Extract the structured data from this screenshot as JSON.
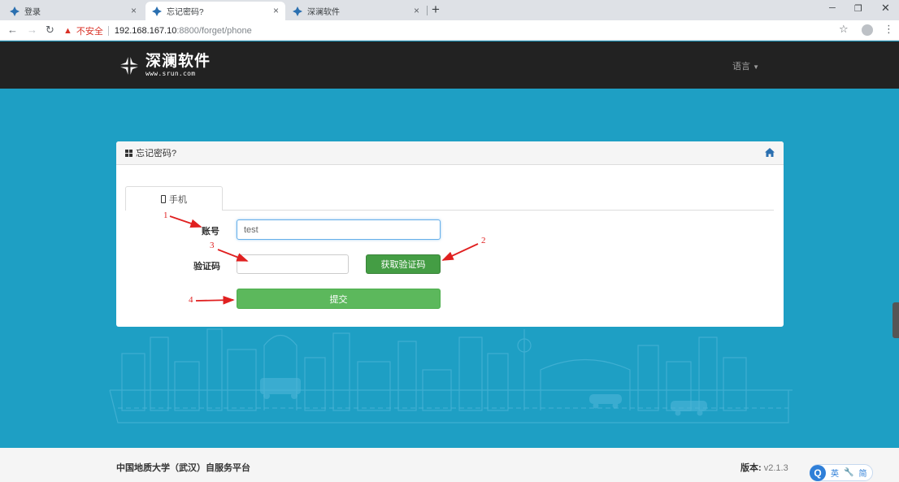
{
  "browser": {
    "tabs": [
      {
        "title": "登录",
        "active": false
      },
      {
        "title": "忘记密码?",
        "active": true
      },
      {
        "title": "深澜软件",
        "active": false
      }
    ],
    "new_tab": "+",
    "security_label": "不安全",
    "url_host": "192.168.167.10",
    "url_rest": ":8800/forget/phone"
  },
  "header": {
    "logo_name": "深澜软件",
    "logo_url": "www.srun.com",
    "language_menu": "语言"
  },
  "panel": {
    "title": "忘记密码?",
    "tab_label": "手机",
    "account_label": "账号",
    "account_value": "test",
    "code_label": "验证码",
    "code_value": "",
    "get_code_button": "获取验证码",
    "submit_button": "提交"
  },
  "annotations": [
    "1",
    "2",
    "3",
    "4"
  ],
  "footer": {
    "platform_name": "中国地质大学（武汉）自服务平台",
    "version_label": "版本:",
    "version_value": "v2.1.3"
  },
  "ime": {
    "logo": "Q",
    "lang": "英",
    "tool": "🔧",
    "mode": "简"
  },
  "colors": {
    "background": "#1e9fc4",
    "header": "#222222",
    "success": "#5cb85c",
    "success_dark": "#449d44",
    "annotation": "#e02020"
  }
}
